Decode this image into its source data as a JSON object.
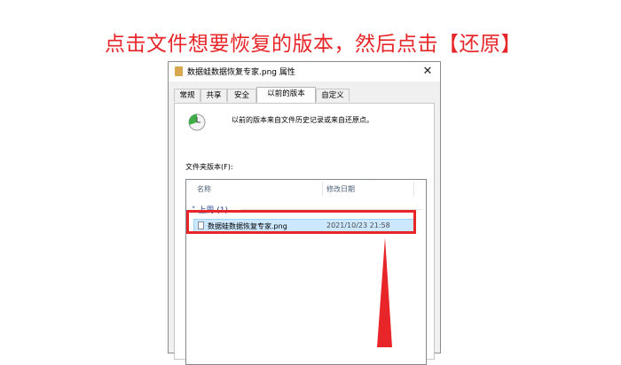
{
  "instruction": "点击文件想要恢复的版本，然后点击【还原】",
  "dialog": {
    "title": "数据蛙数据恢复专家.png 属性",
    "close_glyph": "✕",
    "tabs": [
      {
        "label": "常规",
        "active": false
      },
      {
        "label": "共享",
        "active": false
      },
      {
        "label": "安全",
        "active": false
      },
      {
        "label": "以前的版本",
        "active": true
      },
      {
        "label": "自定义",
        "active": false
      }
    ],
    "info_text": "以前的版本来自文件历史记录或来自还原点。",
    "folder_versions_label": "文件夹版本(F):",
    "list": {
      "columns": {
        "name": "名称",
        "modified": "修改日期"
      },
      "group_label": "上周 (1)",
      "rows": [
        {
          "name": "数据蛙数据恢复专家.png",
          "modified": "2021/10/23 21:58",
          "selected": true
        }
      ]
    }
  },
  "icons": {
    "title": "folder-icon",
    "info": "restore-clock-icon",
    "file": "file-icon",
    "close": "close-icon"
  },
  "colors": {
    "annotation": "#e8262a",
    "selection": "#cce8ff",
    "group_header": "#1e3c8c"
  }
}
